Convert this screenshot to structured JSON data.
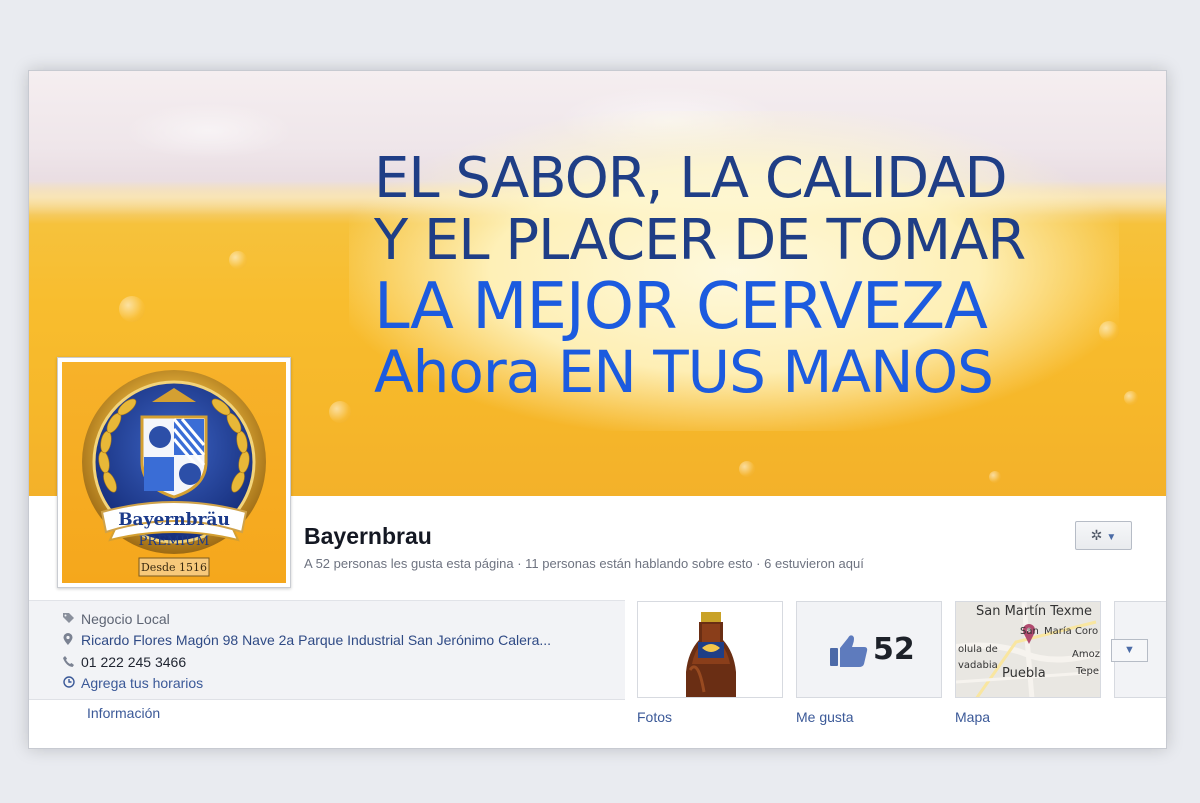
{
  "cover": {
    "line1": "EL SABOR, LA CALIDAD",
    "line2": "Y EL PLACER DE TOMAR",
    "line3": "LA MEJOR CERVEZA",
    "line4": "Ahora EN TUS MANOS"
  },
  "logo": {
    "brand": "Bayernbräu",
    "sub": "PREMIUM",
    "since": "Desde 1516"
  },
  "page": {
    "name": "Bayernbrau",
    "stats": "A 52 personas les gusta esta página · 11 personas están hablando sobre esto · 6 estuvieron aquí",
    "gear_icon": "✲",
    "caret": "▼"
  },
  "info": {
    "category": "Negocio Local",
    "address": "Ricardo Flores Magón 98 Nave 2a Parque Industrial San Jerónimo Calera...",
    "phone": "01 222 245 3466",
    "hours": "Agrega tus horarios",
    "link": "Información"
  },
  "tiles": {
    "fotos": "Fotos",
    "likes_label": "Me gusta",
    "likes_count": "52",
    "map_label": "Mapa"
  },
  "map": {
    "t1": "San Martín Texme",
    "t2": "San",
    "t3": "María Coro",
    "t4": "olula de",
    "t5": "vadabia",
    "t6": "Amoz",
    "t7": "Puebla",
    "t8": "Tepe"
  },
  "colors": {
    "headline_dark": "#1f3e86",
    "headline_bright": "#1c5bdf",
    "fb_link": "#3b5998"
  }
}
